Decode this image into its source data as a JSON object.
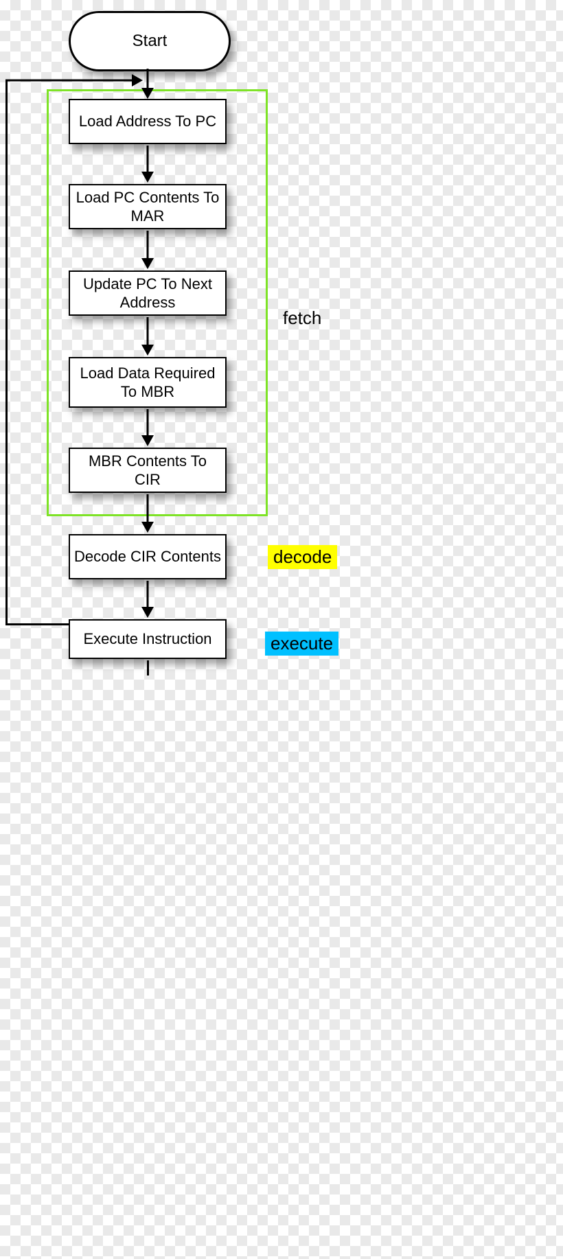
{
  "nodes": {
    "start": "Start",
    "load_addr_pc": "Load Address To PC",
    "load_pc_mar": "Load PC Contents To MAR",
    "update_pc": "Update PC To Next Address",
    "load_data_mbr": "Load Data Required To MBR",
    "mbr_to_cir": "MBR Contents To CIR",
    "decode_cir": "Decode CIR Contents",
    "execute": "Execute Instruction"
  },
  "phases": {
    "fetch": "fetch",
    "decode": "decode",
    "execute": "execute"
  },
  "loop_back": true
}
